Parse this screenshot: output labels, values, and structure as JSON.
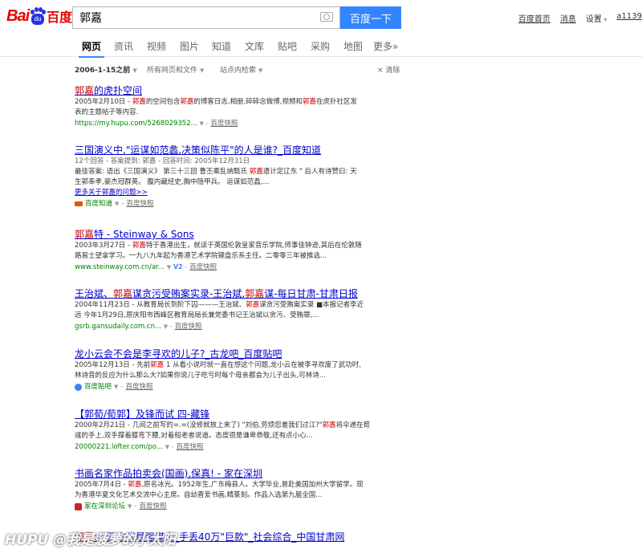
{
  "header": {
    "logo_bai": "Bai",
    "logo_du": "百度",
    "logo_paw_text": "du",
    "search_value": "郭嘉",
    "search_button": "百度一下",
    "links": [
      "百度首页",
      "消息",
      "设置"
    ],
    "user": "a1139"
  },
  "tabs": [
    "网页",
    "资讯",
    "视频",
    "图片",
    "知道",
    "文库",
    "贴吧",
    "采购",
    "地图",
    "更多»"
  ],
  "filters": {
    "date": "2006-1-15之前",
    "scope": "所有网页和文件",
    "site": "站点内检索",
    "clear": "× 清除"
  },
  "results": [
    {
      "title_hl": "郭嘉",
      "title_rest": "的虎扑空间",
      "lines": [
        "2005年2月10日 - 郭嘉的空间包含郭嘉的博客日志,相册,碎碎念微博,视频和郭嘉在虎扑社区发",
        "表的主题帖子等内容."
      ],
      "url": "https://my.hupu.com/5268029352...",
      "cache": "百度快照"
    },
    {
      "title": "三国演义中,\"运谋如范蠡,决策似陈平\"的人是谁?_百度知道",
      "meta": "12个回答 - 答案提到: 郭嘉 - 回答时间: 2005年12月31日",
      "lines": [
        "最佳答案: 语出《三国演义》 第三十三回 曹丕乘乱纳甄氏 郭嘉遗计定辽东 \" 后人有诗赞曰: 天",
        "生郭奉孝,豪杰冠群英。 腹内藏经史,胸中隐甲兵。 运谋如范蠡,..."
      ],
      "more": "更多关于郭嘉的问题>>",
      "source": "百度知道",
      "cache": "百度快照"
    },
    {
      "title_hl": "郭嘉",
      "title_rest": "特 - Steinway & Sons",
      "lines": [
        "2003年3月27日 - 郭嘉特于香港出生，就读于英国伦敦皇家音乐学院,师事佳钟逊,其后在伦敦随",
        "路易士望拿学习。一九八九年起为香港艺术学院键盘乐系主任。二零零三年被推选..."
      ],
      "url": "www.steinway.com.cn/ar...",
      "v2": "V2",
      "cache": "百度快照"
    },
    {
      "title": "王治斌、郭嘉谋贪污受贿案实录-王治斌,郭嘉谋-每日甘肃-甘肃日报",
      "lines": [
        "2004年11月23日 - 从教育局长到阶下囚———王治斌、郭嘉谋贪污受贿案实录 ■本报记者李近",
        "远 今年1月29日,原庆阳市西峰区教育局局长兼党委书记王治斌以贪污、受贿罪,..."
      ],
      "url": "gsrb.gansudaily.com.cn...",
      "cache": "百度快照"
    },
    {
      "title": "龙小云会不会是李寻欢的儿子?_古龙吧_百度贴吧",
      "lines": [
        "2005年12月13日 - 先前郭嘉 1 从看小说时就一直在想这个问题,龙小云在被李寻欢废了武功时,",
        "林诗音的反应为什么那么大?如果你说儿子吃亏时每个母亲都会为儿子出头,可林诗..."
      ],
      "source": "百度贴吧",
      "cache": "百度快照"
    },
    {
      "title": "【郭荀/荀郭】及锋而试 四-藏锋",
      "lines": [
        "2000年2月21日 - 几间之前写的=.=(没修就放上来了) \"刘伯,劳烦您差我们过江?\"郭嘉将伞递在荀",
        "彧的手上,双手撑着膝弯下腰,对着船老者说道。态度很是谦卑恭敬,还有点小心..."
      ],
      "url": "20000221.lofter.com/po...",
      "cache": "百度快照"
    },
    {
      "title": "书画名家作品拍卖会(国画),保真! - 家在深圳",
      "lines": [
        "2005年7月4日 - 郭嘉,原名冰光。1952年生,广东梅县人。大学毕业,曾赴美国加州大学留学。现",
        "为香港华夏文化艺术交流中心主席。自幼喜爱书画,精篆刻。作品入选第九届全国..."
      ],
      "source": "家在深圳论坛",
      "cache": "百度快照"
    }
  ],
  "cutoff_title": "郭嘉:中国古代最强谋士_手丢40万\"巨款\"_社会综合_中国甘肃网",
  "watermark": "HUPU @我是菠萝的小太阳",
  "colors": {
    "link": "#0000cc",
    "highlight": "#cc0000",
    "url": "#008000",
    "button": "#3385ff",
    "logo_red": "#e10602",
    "logo_blue": "#2932e1"
  }
}
